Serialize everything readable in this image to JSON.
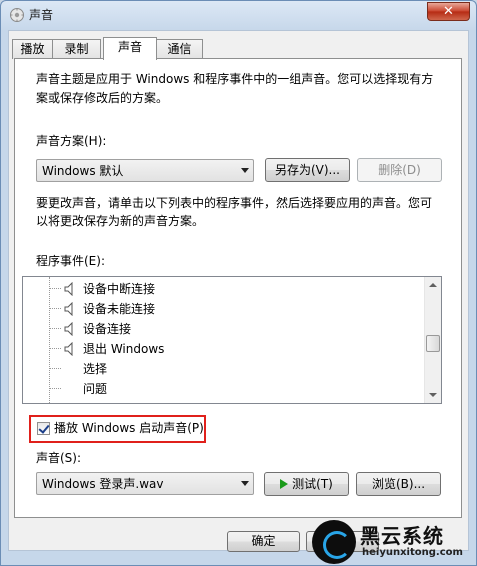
{
  "window": {
    "title": "声音",
    "close_label": "✕"
  },
  "tabs": [
    {
      "label": "播放",
      "active": false
    },
    {
      "label": "录制",
      "active": false
    },
    {
      "label": "声音",
      "active": true
    },
    {
      "label": "通信",
      "active": false
    }
  ],
  "description": {
    "line1": "声音主题是应用于 Windows 和程序事件中的一组声音。您可以选择现有方",
    "line2": "案或保存修改后的方案。"
  },
  "scheme": {
    "label": "声音方案(H):",
    "selected": "Windows 默认",
    "save_as_label": "另存为(V)...",
    "delete_label": "删除(D)"
  },
  "instructions": {
    "line1": "要更改声音，请单击以下列表中的程序事件，然后选择要应用的声音。您可",
    "line2": "以将更改保存为新的声音方案。"
  },
  "events": {
    "label": "程序事件(E):",
    "items": [
      {
        "label": "设备中断连接",
        "has_sound": true
      },
      {
        "label": "设备未能连接",
        "has_sound": true
      },
      {
        "label": "设备连接",
        "has_sound": true
      },
      {
        "label": "退出 Windows",
        "has_sound": true
      },
      {
        "label": "选择",
        "has_sound": false
      },
      {
        "label": "问题",
        "has_sound": false
      }
    ]
  },
  "startup_sound": {
    "label": "播放 Windows 启动声音(P)",
    "checked": true
  },
  "sound": {
    "label": "声音(S):",
    "selected": "Windows 登录声.wav",
    "test_label": "测试(T)",
    "browse_label": "浏览(B)..."
  },
  "footer": {
    "ok_label": "确定",
    "cancel_label": "取"
  },
  "watermark": {
    "title": "黑云系统",
    "url": "heiyunxitong.com"
  },
  "colors": {
    "highlight_border": "#e0201b",
    "play_green": "#1a9a1a",
    "close_red": "#c9432c"
  }
}
